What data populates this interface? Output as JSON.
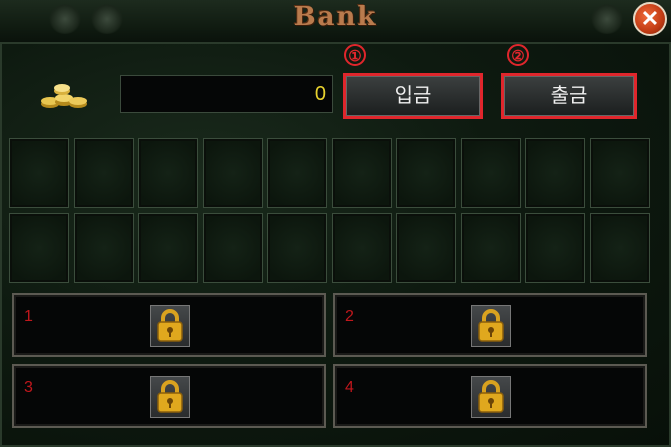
{
  "window": {
    "title": "Bank",
    "close_glyph": "✕"
  },
  "gold": {
    "amount": "0",
    "icon": "gold-coins-icon"
  },
  "buttons": {
    "deposit": "입금",
    "withdraw": "출금"
  },
  "markers": {
    "m1": "①",
    "m2": "②"
  },
  "colors": {
    "highlight": "#e0262c",
    "gold_text": "#e8d22e",
    "slot_number": "#c1171c"
  },
  "storage": {
    "rows": 2,
    "cols": 10
  },
  "locked_slots": [
    {
      "number": "1"
    },
    {
      "number": "2"
    },
    {
      "number": "3"
    },
    {
      "number": "4"
    }
  ]
}
